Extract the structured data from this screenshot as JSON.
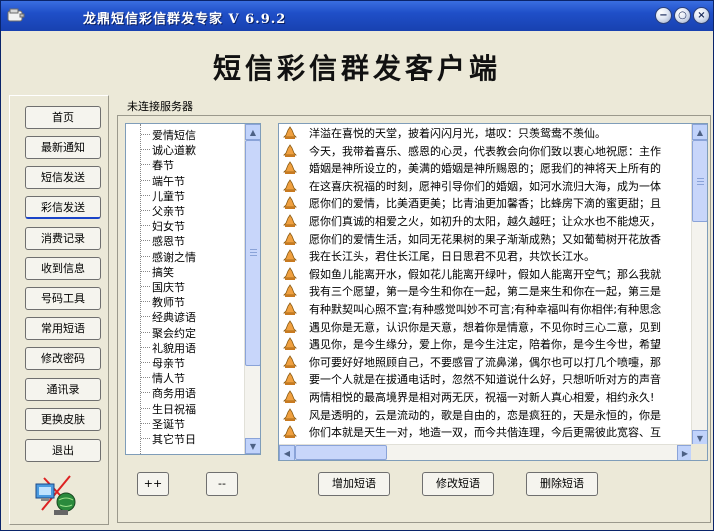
{
  "window": {
    "title": "龙鼎短信彩信群发专家 V 6.9.2",
    "banner": "短信彩信群发客户端"
  },
  "sidebar": {
    "items": [
      {
        "label": "首页",
        "name": "sidebar-item-home"
      },
      {
        "label": "最新通知",
        "name": "sidebar-item-notices"
      },
      {
        "label": "短信发送",
        "name": "sidebar-item-sms-send"
      },
      {
        "label": "彩信发送",
        "name": "sidebar-item-mms-send",
        "active": true
      },
      {
        "label": "消费记录",
        "name": "sidebar-item-consumption"
      },
      {
        "label": "收到信息",
        "name": "sidebar-item-inbox"
      },
      {
        "label": "号码工具",
        "name": "sidebar-item-number-tools"
      },
      {
        "label": "常用短语",
        "name": "sidebar-item-phrases"
      },
      {
        "label": "修改密码",
        "name": "sidebar-item-password"
      },
      {
        "label": "通讯录",
        "name": "sidebar-item-contacts"
      },
      {
        "label": "更换皮肤",
        "name": "sidebar-item-skin"
      },
      {
        "label": "退出",
        "name": "sidebar-item-exit"
      }
    ]
  },
  "status": "未连接服务器",
  "categories": [
    "爱情短信",
    "诚心道歉",
    "春节",
    "端午节",
    "儿童节",
    "父亲节",
    "妇女节",
    "感恩节",
    "感谢之情",
    "搞笑",
    "国庆节",
    "教师节",
    "经典谚语",
    "聚会约定",
    "礼貌用语",
    "母亲节",
    "情人节",
    "商务用语",
    "生日祝福",
    "圣诞节",
    "其它节日"
  ],
  "messages": [
    "洋溢在喜悦的天堂，披着闪闪月光，堪叹：只羡鸳鸯不羡仙。",
    "今天，我带着喜乐、感恩的心灵，代表教会向你们致以衷心地祝愿：主作",
    "婚姻是神所设立的，美满的婚姻是神所赐恩的；愿我们的神将天上所有的",
    "在这喜庆祝福的时刻，愿神引导你们的婚姻，如河水流归大海，成为一体",
    "愿你们的爱情，比美酒更美；比青油更加馨香；比蜂房下滴的蜜更甜；且",
    "愿你们真诚的相爱之火，如初升的太阳，越久越旺；让众水也不能熄灭，",
    "愿你们的爱情生活，如同无花果树的果子渐渐成熟；又如葡萄树开花放香",
    "我在长江头，君住长江尾，日日思君不见君，共饮长江水。",
    "假如鱼儿能离开水，假如花儿能离开绿叶，假如人能离开空气；那么我就",
    "我有三个愿望，第一是今生和你在一起，第二是来生和你在一起，第三是",
    "有种默契叫心照不宣;有种感觉叫妙不可言;有种幸福叫有你相伴;有种思念",
    "遇见你是无意，认识你是天意，想着你是情意，不见你时三心二意，见到",
    "遇见你，是今生缘分，爱上你，是今生注定，陪着你，是今生今世，希望",
    "你可要好好地照顾自己，不要感冒了流鼻涕，偶尔也可以打几个喷嚏，那",
    "要一个人就是在拔通电话时，忽然不知道说什么好，只想听听对方的声音",
    "两情相悦的最高境界是相对两无厌，祝福一对新人真心相爱，相约永久!",
    "风是透明的，云是流动的，歌是自由的，恋是疯狂的，天是永恒的，你是",
    "你们本就是天生一对，地造一双，而今共偕连理，今后更需彼此宽容、互"
  ],
  "buttons": {
    "add_category": "++",
    "remove_category": "--",
    "add_sms": "增加短语",
    "edit_sms": "修改短语",
    "delete_sms": "删除短语"
  },
  "titlebar_buttons": {
    "minimize": "−",
    "restore": "○",
    "close": "×"
  }
}
